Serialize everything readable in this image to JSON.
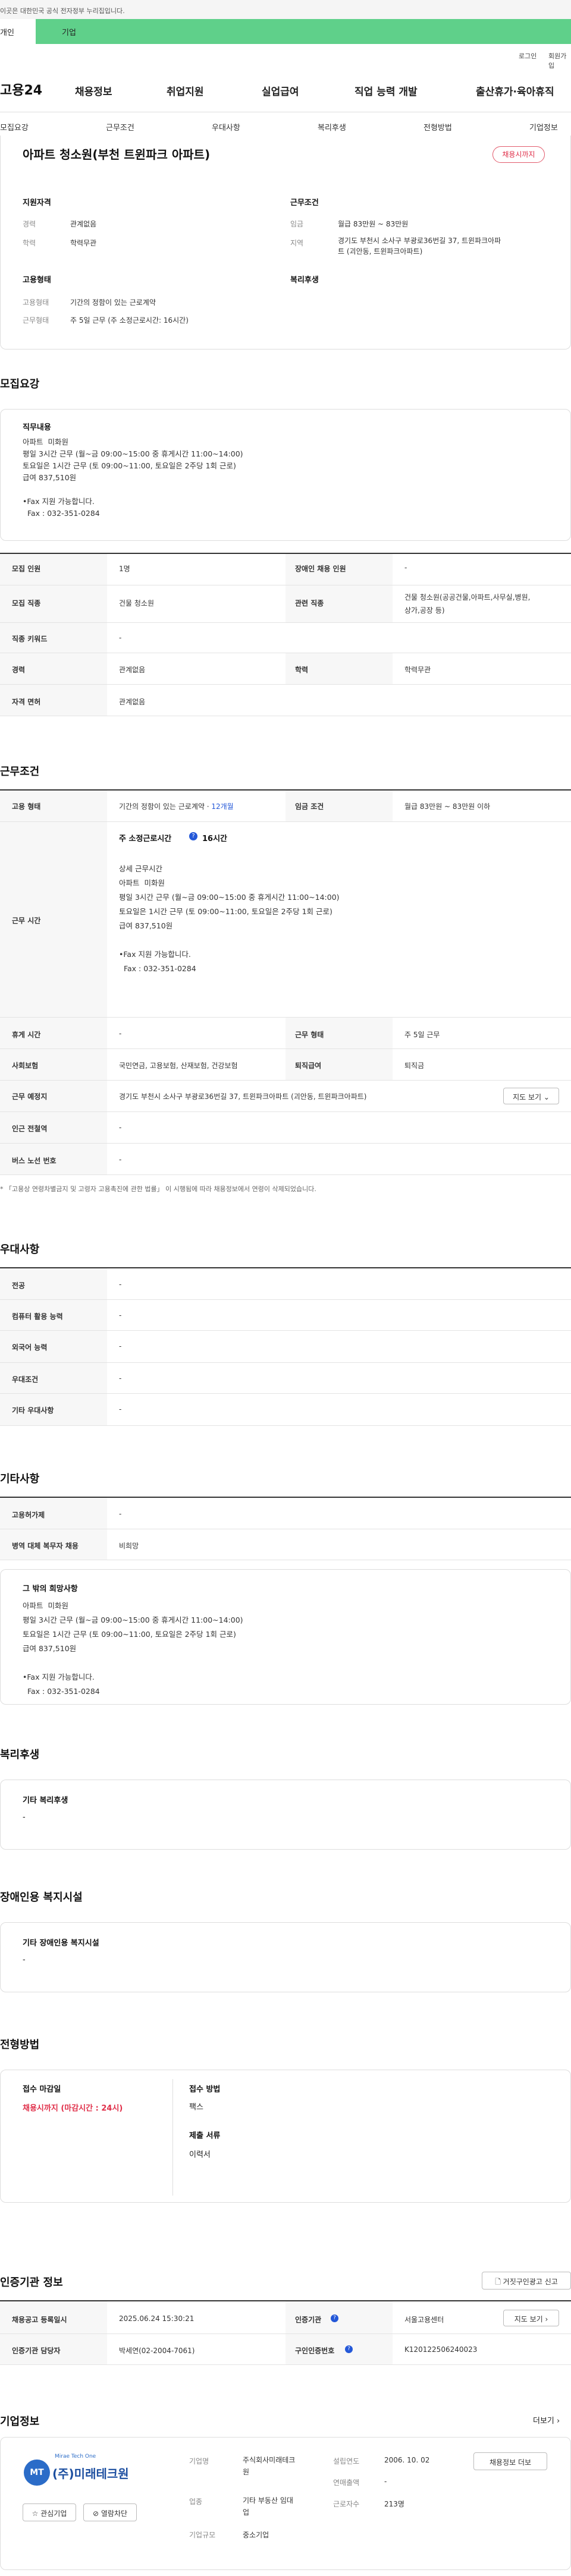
{
  "topbar": {
    "notice": "이곳은 대한민국 공식 전자정부 누리집입니다."
  },
  "greenbar": {
    "tab1": "개인",
    "tab2": "기업"
  },
  "util": {
    "login": "로그인",
    "join": "회원가입"
  },
  "header": {
    "logo": "고용24",
    "gnb": [
      "채용정보",
      "취업지원",
      "실업급여",
      "직업 능력 개발",
      "출산휴가·육아휴직"
    ]
  },
  "subnav": [
    "모집요강",
    "근무조건",
    "우대사항",
    "복리후생",
    "전형방법",
    "기업정보"
  ],
  "job": {
    "title": "아파트 청소원(부천 트윈파크 아파트)",
    "status_badge": "채용시까지",
    "qual_title": "지원자격",
    "career_label": "경력",
    "career_value": "관계없음",
    "edu_label": "학력",
    "edu_value": "학력무관",
    "emp_title": "고용형태",
    "emp_type_label": "고용형태",
    "emp_type_value": "기간의 정함이 있는 근로계약",
    "work_type_label": "근무형태",
    "work_type_value": "주 5일 근무 (주 소정근로시간: 16시간)",
    "cond_title": "근무조건",
    "wage_label": "임금",
    "wage_value": "월급 83만원 ~ 83만원",
    "region_label": "지역",
    "region_value_1": "경기도 부천시 소사구 부광로36번길 37, 트윈파크아파",
    "region_value_2": "트 (괴안동, 트윈파크아파트)",
    "welfare_title": "복리후생"
  },
  "recruit": {
    "title": "모집요강",
    "duty_title": "직무내용",
    "duty_text": "아파트  미화원\n평일 3시간 근무 (월~금 09:00~15:00 중 휴게시간 11:00~14:00)\n토요일은 1시간 근무 (토 09:00~11:00, 토요일은 2주당 1회 근로)\n급여 837,510원\n\n•Fax 지원 가능합니다.\n  Fax : 032-351-0284",
    "rows": [
      {
        "k1": "모집 인원",
        "v1": "1명",
        "k2": "장애인 채용 인원",
        "v2": "-"
      },
      {
        "k1": "모집 직종",
        "v1": "건물 청소원",
        "k2": "관련 직종",
        "v2": "건물 청소원(공공건물,아파트,사무실,병원,",
        "v2b": "상가,공장 등)"
      },
      {
        "k1": "직종 키워드",
        "v1": "-"
      },
      {
        "k1": "경력",
        "v1": "관계없음",
        "k2": "학력",
        "v2": "학력무관"
      },
      {
        "k1": "자격 면허",
        "v1": "관계없음"
      }
    ]
  },
  "work": {
    "title": "근무조건",
    "emp_label": "고용 형태",
    "emp_value": "기간의 정함이 있는 근로계약 · ",
    "emp_period": "12개월",
    "wage_label": "임금 조건",
    "wage_value": "월급 83만원 ~ 83만원 이하",
    "time_label": "근무 시간",
    "hours_title": "주 소정근로시간",
    "hours_value": "16시간",
    "detail_text": "상세 근무시간\n아파트  미화원\n평일 3시간 근무 (월~금 09:00~15:00 중 휴게시간 11:00~14:00)\n토요일은 1시간 근무 (토 09:00~11:00, 토요일은 2주당 1회 근로)\n급여 837,510원\n\n•Fax 지원 가능합니다.\n  Fax : 032-351-0284",
    "break_label": "휴게 시간",
    "break_value": "-",
    "form_label": "근무 형태",
    "form_value": "주 5일 근무",
    "insurance_label": "사회보험",
    "insurance_value": "국민연금, 고용보험, 산재보험, 건강보험",
    "retire_label": "퇴직급여",
    "retire_value": "퇴직금",
    "place_label": "근무 예정지",
    "place_value": "경기도 부천시 소사구 부광로36번길 37, 트윈파크아파트 (괴안동, 트윈파크아파트)",
    "map_btn": "지도 보기",
    "subway_label": "인근 전철역",
    "subway_value": "-",
    "bus_label": "버스 노선 번호",
    "bus_value": "-",
    "footnote": "* 「고용상 연령차별금지 및 고령자 고용촉진에 관한 법률」 이 시행됨에 따라 채용정보에서 연령이 삭제되었습니다."
  },
  "pref": {
    "title": "우대사항",
    "rows": [
      {
        "k": "전공",
        "v": "-"
      },
      {
        "k": "컴퓨터 활용 능력",
        "v": "-"
      },
      {
        "k": "외국어 능력",
        "v": "-"
      },
      {
        "k": "우대조건",
        "v": "-"
      },
      {
        "k": "기타 우대사항",
        "v": "-"
      }
    ]
  },
  "etc": {
    "title": "기타사항",
    "rows": [
      {
        "k": "고용허가제",
        "v": "-"
      },
      {
        "k": "병역 대체 복무자 채용",
        "v": "비희망"
      }
    ],
    "box_title": "그 밖의 희망사항",
    "box_text": "아파트  미화원\n평일 3시간 근무 (월~금 09:00~15:00 중 휴게시간 11:00~14:00)\n토요일은 1시간 근무 (토 09:00~11:00, 토요일은 2주당 1회 근로)\n급여 837,510원\n\n•Fax 지원 가능합니다.\n  Fax : 032-351-0284"
  },
  "welfare": {
    "title": "복리후생",
    "box_title": "기타 복리후생",
    "box_value": "-"
  },
  "disabled": {
    "title": "장애인용 복지시설",
    "box_title": "기타 장애인용 복지시설",
    "box_value": "-"
  },
  "select": {
    "title": "전형방법",
    "deadline_title": "접수 마감일",
    "deadline_value": "채용시까지 (마감시간 : 24시)",
    "method_title": "접수 방법",
    "method_value": "팩스",
    "docs_title": "제출 서류",
    "docs_value": "이력서"
  },
  "cert": {
    "title": "인증기관 정보",
    "report_btn": "거짓구인광고 신고",
    "reg_label": "채용공고 등록일시",
    "reg_value": "2025.06.24 15:30:21",
    "org_label": "인증기관",
    "org_value": "서울고용센터",
    "map_btn": "지도 보기",
    "manager_label": "인증기관 담당자",
    "manager_value": "박세연(02-2004-7061)",
    "id_label": "구인인증번호",
    "id_value": "K120122506240023"
  },
  "company": {
    "title": "기업정보",
    "more": "더보기",
    "logo_text": "(주)미래테크원",
    "logo_small": "Mirae Tech One",
    "fav_btn": "관심기업",
    "block_btn": "열람차단",
    "name_label": "기업명",
    "name_value_1": "주식회사미래테크",
    "name_value_2": "원",
    "founded_label": "설립연도",
    "founded_value": "2006. 10. 02",
    "info_btn": "채용정보 더보",
    "industry_label": "업종",
    "industry_value_1": "기타 부동산 임대",
    "industry_value_2": "업",
    "sales_label": "연매출액",
    "sales_value": "-",
    "staff_label": "근로자수",
    "staff_value": "213명",
    "size_label": "기업규모",
    "size_value": "중소기업"
  },
  "colors": {
    "green": "#5fd08a",
    "badge_red": "#e0304a",
    "link_blue": "#2458d8"
  }
}
